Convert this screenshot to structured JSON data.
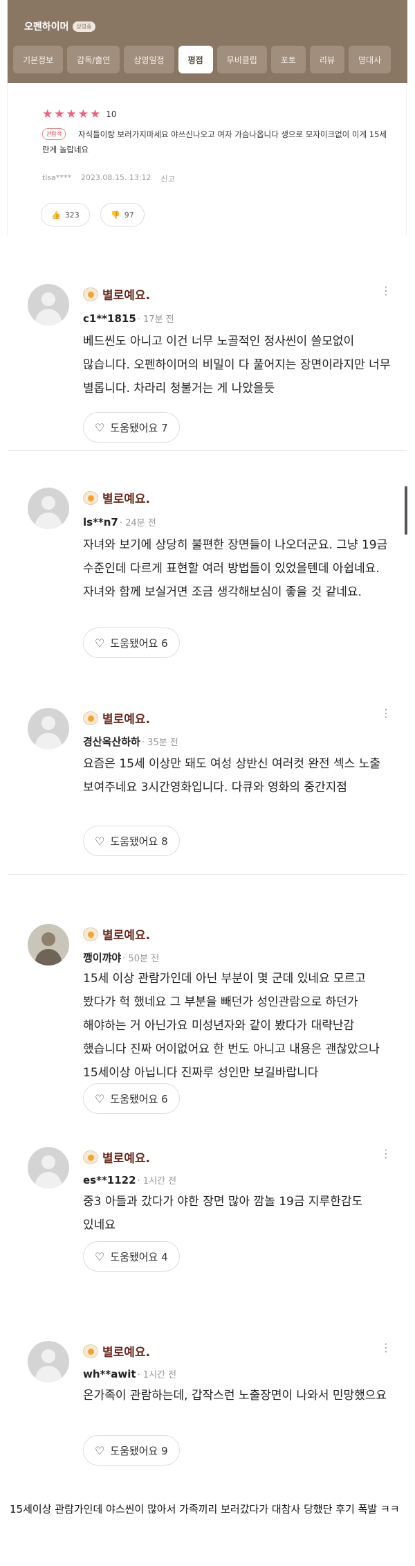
{
  "header": {
    "title": "오펜하이머",
    "badge": "상영중",
    "tabs": [
      "기본정보",
      "감독/출연",
      "상영일정",
      "평점",
      "무비클립",
      "포토",
      "리뷰",
      "명대사"
    ],
    "active_tab": "평점"
  },
  "top_review": {
    "score": "10",
    "viewer_tag": "관람객",
    "text": "자식들이랑 보러가지마세요 야쓰신나오고 여자 가슴나옵니다 생으로 모자이크없이 이게 15세란게 놀랍네요",
    "author": "tlsa****",
    "date": "2023.08.15. 13:12",
    "report": "신고",
    "likes": "323",
    "dislikes": "97"
  },
  "reviews": [
    {
      "rating": "별로예요.",
      "user": "c1**1815",
      "time": "· 17분 전",
      "text": "베드씬도 아니고 이건 너무 노골적인 정사씬이 쓸모없이 많습니다. 오펜하이머의 비밀이 다 풀어지는 장면이라지만 너무 별롭니다. 차라리 청불거는 게 나았을듯",
      "helpful": "도움됐어요 7"
    },
    {
      "rating": "별로예요.",
      "user": "ls**n7",
      "time": "· 24분 전",
      "text": "자녀와 보기에 상당히 불편한 장면들이 나오더군요. 그냥 19금 수준인데 다르게 표현할 여러 방법들이 있었을텐데 아쉽네요. 자녀와 함께 보실거면 조금 생각해보심이 좋을 것 같네요.",
      "helpful": "도움됐어요 6"
    },
    {
      "rating": "별로예요.",
      "user": "경산옥산하하",
      "time": "· 35분 전",
      "text": "요즘은 15세 이상만 돼도 여성 상반신 여러컷 완전 섹스 노출 보여주네요 3시간영화입니다. 다큐와 영화의 중간지점",
      "helpful": "도움됐어요 8"
    },
    {
      "rating": "별로예요.",
      "user": "깽이꺄야",
      "time": "· 50분 전",
      "text": "15세 이상 관람가인데 아닌 부분이 몇 군데 있네요 모르고 봤다가 헉 했네요 그 부분을 빼던가 성인관람으로 하던가 해야하는 거 아닌가요 미성년자와 같이 봤다가 대략난감 했습니다 진짜 어이없어요 한 번도 아니고 내용은 괜찮았으나 15세이상 아닙니다 진짜루 성인만 보길바랍니다",
      "helpful": "도움됐어요 6"
    },
    {
      "rating": "별로예요.",
      "user": "es**1122",
      "time": "· 1시간 전",
      "text": "중3 아들과 갔다가 야한 장면 많아 깜놀 19금 지루한감도 있네요",
      "helpful": "도움됐어요 4"
    },
    {
      "rating": "별로예요.",
      "user": "wh**awit",
      "time": "· 1시간 전",
      "text": "온가족이 관람하는데, 갑작스런 노출장면이 나와서 민망했으요",
      "helpful": "도움됐어요 9"
    }
  ],
  "caption": "15세이상 관람가인데 야스씬이 많아서 가족끼리 보러갔다가 대참사 당했단 후기 폭발 ㅋㅋ",
  "colors": {
    "header_bg": "#8a7763",
    "star": "#f05e7b",
    "rating_label": "#6b2a1c"
  }
}
